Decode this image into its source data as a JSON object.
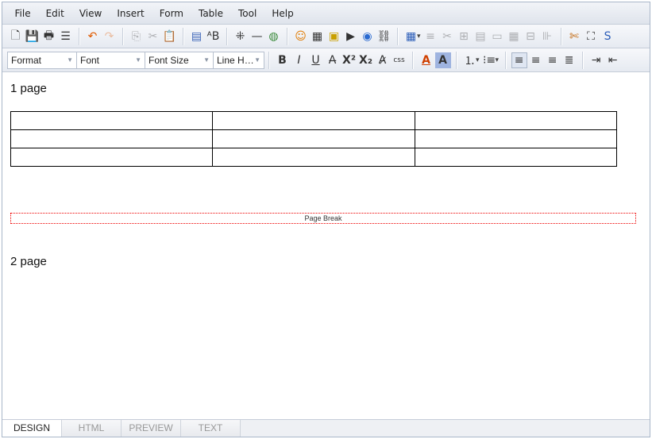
{
  "menu": [
    "File",
    "Edit",
    "View",
    "Insert",
    "Form",
    "Table",
    "Tool",
    "Help"
  ],
  "toolbar1": [
    {
      "name": "new-document",
      "g": "🗋"
    },
    {
      "name": "save",
      "g": "💾"
    },
    {
      "name": "print",
      "g": "🖶"
    },
    {
      "name": "page-break",
      "g": "☰"
    },
    "|",
    {
      "name": "undo",
      "g": "↶",
      "c": "#e05a00"
    },
    {
      "name": "redo",
      "g": "↷",
      "c": "#e05a00",
      "dis": true
    },
    "|",
    {
      "name": "copy",
      "g": "⎘",
      "dis": true
    },
    {
      "name": "cut",
      "g": "✂",
      "dis": true
    },
    {
      "name": "paste",
      "g": "📋"
    },
    "|",
    {
      "name": "text-box",
      "g": "▤",
      "c": "#3a63b8"
    },
    {
      "name": "spell-check",
      "g": "ᴬB"
    },
    "|",
    {
      "name": "special-char",
      "g": "⁜"
    },
    {
      "name": "horizontal-rule",
      "g": "—"
    },
    {
      "name": "link-globe",
      "g": "◍",
      "c": "#3a8a3a"
    },
    "|",
    {
      "name": "emoticon",
      "g": "☺",
      "c": "#e07a00"
    },
    {
      "name": "background",
      "g": "▦"
    },
    {
      "name": "image",
      "g": "▣",
      "c": "#c9a000"
    },
    {
      "name": "media",
      "g": "▶"
    },
    {
      "name": "flash",
      "g": "◉",
      "c": "#2a6ad0"
    },
    {
      "name": "hyperlink",
      "g": "⛓"
    },
    "|",
    {
      "name": "table",
      "g": "▦",
      "c": "#2a5cb8",
      "dd": true
    },
    {
      "name": "insert-row",
      "g": "≡",
      "dis": true
    },
    {
      "name": "delete-row",
      "g": "✂",
      "dis": true
    },
    {
      "name": "merge-cells",
      "g": "⊞",
      "dis": true
    },
    {
      "name": "cell-props",
      "g": "▤",
      "dis": true
    },
    {
      "name": "table-props",
      "g": "▭",
      "dis": true
    },
    {
      "name": "split-cell",
      "g": "▦",
      "dis": true
    },
    {
      "name": "split-rows",
      "g": "⊟",
      "dis": true
    },
    {
      "name": "split-cols",
      "g": "⊪",
      "dis": true
    },
    "|",
    {
      "name": "tools",
      "g": "✄",
      "c": "#c06000"
    },
    {
      "name": "fullscreen",
      "g": "⛶"
    },
    {
      "name": "source",
      "g": "S",
      "c": "#2a5cb8"
    }
  ],
  "selects": [
    {
      "label": "Format",
      "w": 88
    },
    {
      "label": "Font",
      "w": 87
    },
    {
      "label": "Font Size",
      "w": 87
    },
    {
      "label": "Line H…",
      "w": 65
    }
  ],
  "toolbar2": [
    "|",
    {
      "name": "bold",
      "g": "B"
    },
    {
      "name": "italic",
      "g": "I"
    },
    {
      "name": "underline",
      "g": "U"
    },
    {
      "name": "strikethrough",
      "g": "A̶"
    },
    {
      "name": "superscript",
      "g": "X²"
    },
    {
      "name": "subscript",
      "g": "X₂"
    },
    {
      "name": "clear-format",
      "g": "A̷"
    },
    {
      "name": "css-style",
      "g": "css"
    },
    "|",
    {
      "name": "font-color",
      "g": "A",
      "c": "#d04000"
    },
    {
      "name": "background-color",
      "g": "A",
      "bg": "#9fb4e0"
    },
    "|",
    {
      "name": "ordered-list",
      "g": "⒈",
      "dd": true
    },
    {
      "name": "unordered-list",
      "g": "⁝≡",
      "dd": true
    },
    "|",
    {
      "name": "align-left",
      "g": "≡",
      "act": true
    },
    {
      "name": "align-center",
      "g": "≡"
    },
    {
      "name": "align-right",
      "g": "≡"
    },
    {
      "name": "align-justify",
      "g": "≣"
    },
    "|",
    {
      "name": "indent",
      "g": "⇥"
    },
    {
      "name": "outdent",
      "g": "⇤"
    }
  ],
  "content": {
    "page1": "1 page",
    "page_break": "Page Break",
    "page2": "2 page",
    "table_rows": 3,
    "table_cols": 3
  },
  "tabs": [
    {
      "label": "DESIGN",
      "active": true
    },
    {
      "label": "HTML"
    },
    {
      "label": "PREVIEW"
    },
    {
      "label": "TEXT"
    }
  ]
}
